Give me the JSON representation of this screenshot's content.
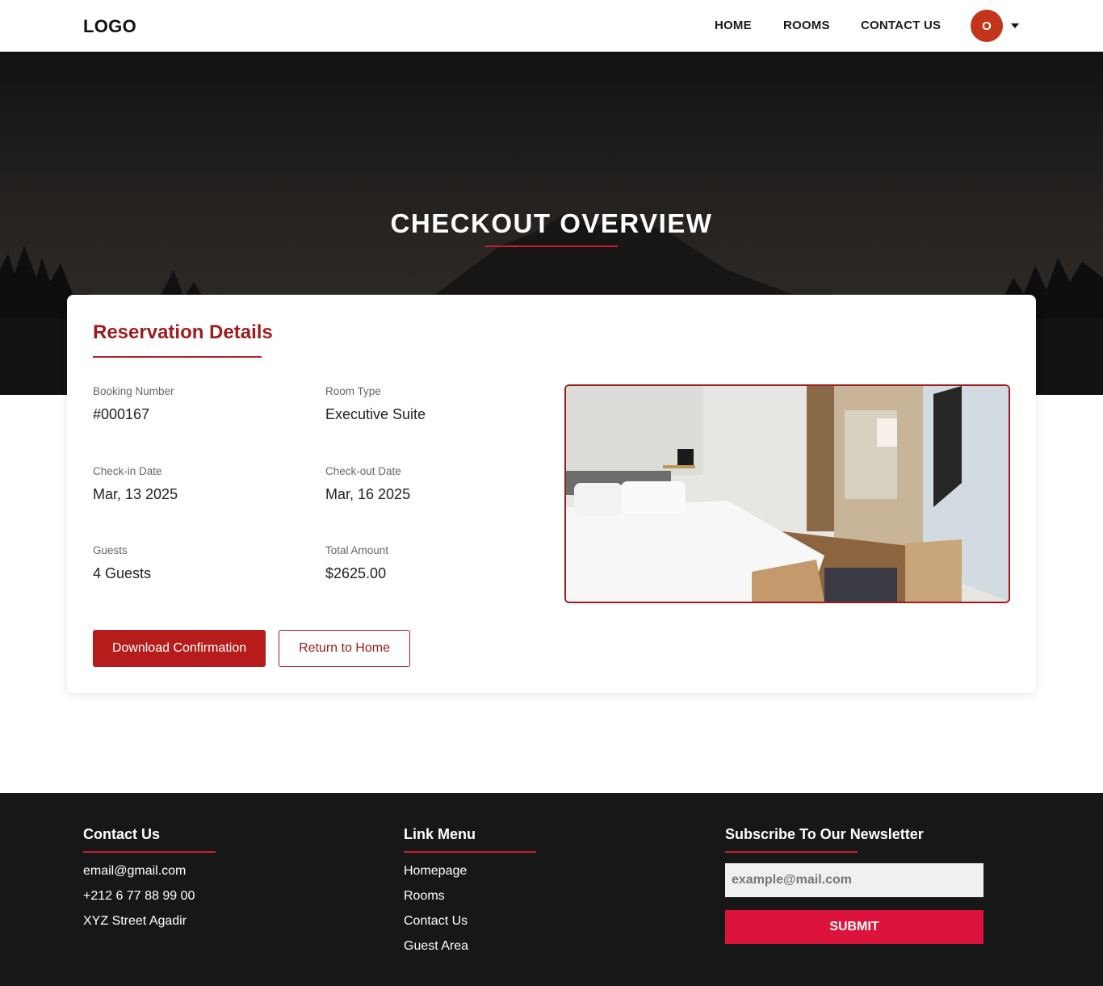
{
  "header": {
    "logo": "LOGO",
    "nav": [
      "HOME",
      "ROOMS",
      "CONTACT US"
    ],
    "avatar_initial": "O"
  },
  "hero": {
    "title": "CHECKOUT OVERVIEW"
  },
  "reservation": {
    "title": "Reservation Details",
    "fields": [
      {
        "label": "Booking Number",
        "value": "#000167"
      },
      {
        "label": "Room Type",
        "value": "Executive Suite"
      },
      {
        "label": "Check-in Date",
        "value": "Mar, 13 2025"
      },
      {
        "label": "Check-out Date",
        "value": "Mar, 16 2025"
      },
      {
        "label": "Guests",
        "value": "4 Guests"
      },
      {
        "label": "Total Amount",
        "value": "$2625.00"
      }
    ],
    "download_button": "Download Confirmation",
    "return_button": "Return to Home"
  },
  "footer": {
    "contact": {
      "title": "Contact Us",
      "items": [
        "email@gmail.com",
        "+212 6 77 88 99 00",
        "XYZ Street Agadir"
      ]
    },
    "links": {
      "title": "Link Menu",
      "items": [
        "Homepage",
        "Rooms",
        "Contact Us",
        "Guest Area"
      ]
    },
    "newsletter": {
      "title": "Subscribe To Our Newsletter",
      "placeholder": "example@mail.com",
      "submit": "SUBMIT"
    }
  },
  "colors": {
    "accent": "#b71c1c",
    "submit": "#dc143c",
    "avatar": "#c2351b",
    "footer_bg": "#171717"
  }
}
